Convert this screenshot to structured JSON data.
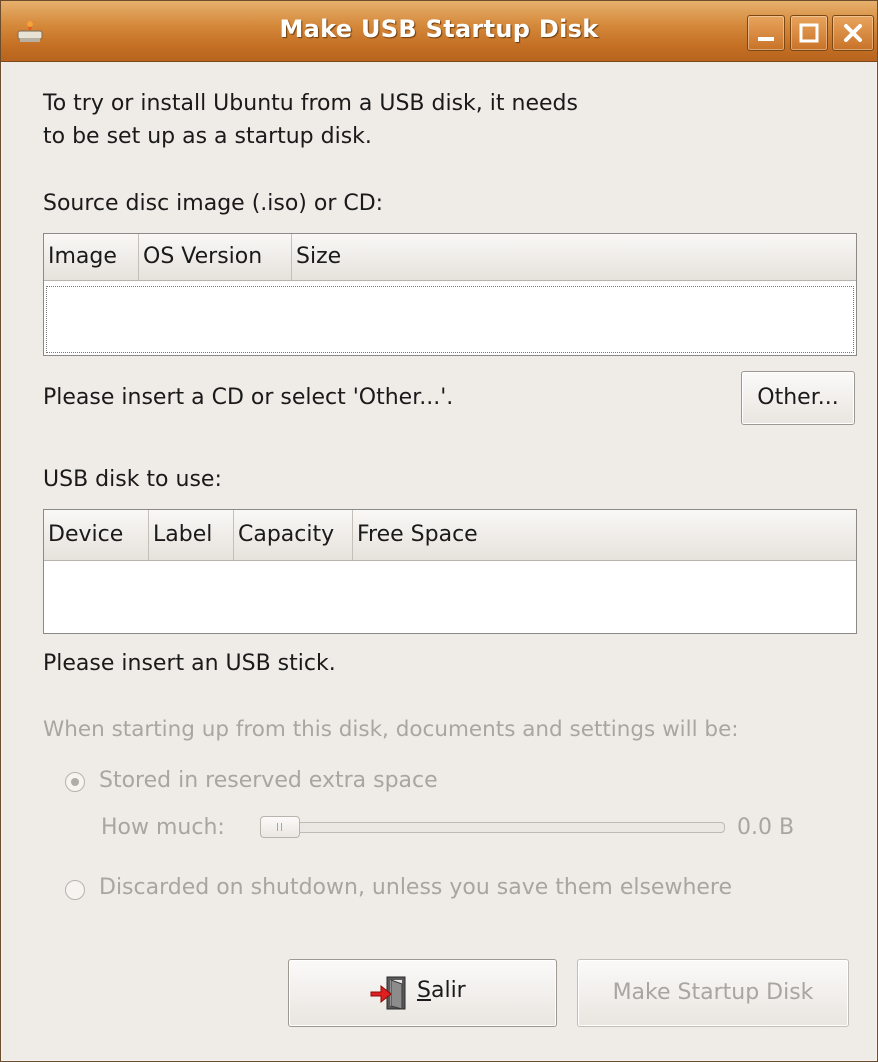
{
  "window": {
    "title": "Make USB Startup Disk",
    "icon": "usb-creator-icon"
  },
  "titlebar_buttons": {
    "minimize_icon": "minimize-icon",
    "maximize_icon": "maximize-icon",
    "close_icon": "close-icon"
  },
  "intro": {
    "line1": "To try or install Ubuntu from a USB disk, it needs",
    "line2": "to be set up as a startup disk."
  },
  "source": {
    "label": "Source disc image (.iso) or CD:",
    "columns": [
      "Image",
      "OS Version",
      "Size"
    ],
    "rows": [],
    "status": "Please insert a CD or select 'Other...'.",
    "other_button": "Other..."
  },
  "usb": {
    "label": "USB disk to use:",
    "columns": [
      "Device",
      "Label",
      "Capacity",
      "Free Space"
    ],
    "rows": [],
    "status": "Please insert an USB stick."
  },
  "persistence": {
    "heading": "When starting up from this disk, documents and settings will be:",
    "option_stored": "Stored in reserved extra space",
    "how_much_label": "How much:",
    "how_much_value": "0.0 B",
    "slider_fraction": 0,
    "option_discarded": "Discarded on shutdown, unless you save them elsewhere",
    "selected": "stored"
  },
  "actions": {
    "quit_label": "Salir",
    "quit_mnemonic": "S",
    "make_label": "Make Startup Disk"
  },
  "colors": {
    "titlebar_orange": "#d5893b",
    "window_bg": "#efebe7",
    "disabled_text": "#a9a6a1"
  }
}
